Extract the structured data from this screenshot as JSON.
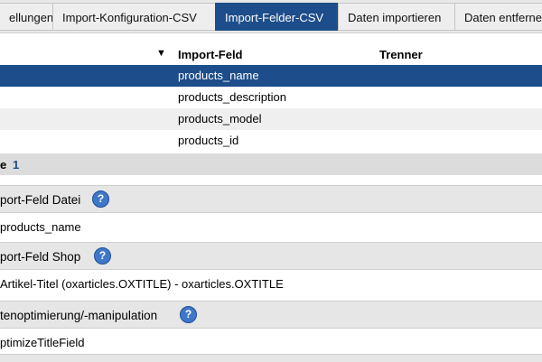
{
  "tabs": [
    {
      "label": "ellungen"
    },
    {
      "label": "Import-Konfiguration-CSV"
    },
    {
      "label": "Import-Felder-CSV",
      "active": true
    },
    {
      "label": "Daten importieren"
    },
    {
      "label": "Daten entferne"
    }
  ],
  "list": {
    "sort_icon": "triangle-down-icon",
    "col_field": "Import-Feld",
    "col_separator": "Trenner",
    "rows": [
      {
        "value": "products_name"
      },
      {
        "value": "products_description"
      },
      {
        "value": "products_model"
      },
      {
        "value": "products_id"
      }
    ]
  },
  "pager": {
    "label": "e",
    "current": "1"
  },
  "sections": [
    {
      "title": "port-Feld Datei",
      "value": "products_name"
    },
    {
      "title": "port-Feld Shop",
      "value": "Artikel-Titel (oxarticles.OXTITLE) - oxarticles.OXTITLE"
    },
    {
      "title": "tenoptimierung/-manipulation",
      "value": "ptimizeTitleField"
    }
  ],
  "help_symbol": "?",
  "colors": {
    "accent": "#1d4d8a",
    "help": "#3f78c8"
  }
}
